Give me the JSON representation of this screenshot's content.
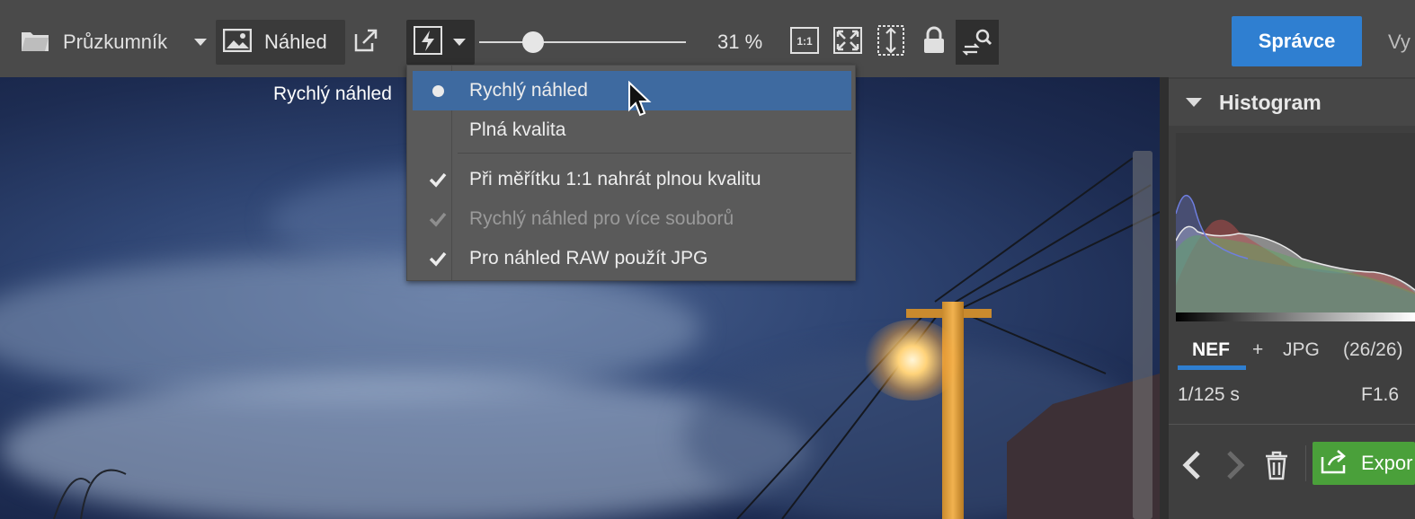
{
  "toolbar": {
    "explorer_label": "Průzkumník",
    "preview_label": "Náhled",
    "zoom_value": "31 %",
    "zoom_slider_fraction": 0.26,
    "one_to_one_label": "1:1",
    "manager_label": "Správce",
    "next_tab_label": "Vy"
  },
  "viewport": {
    "overlay_text": "Rychlý náhled"
  },
  "quality_menu": {
    "items": [
      {
        "label": "Rychlý náhled",
        "indicator": "dot",
        "active": true,
        "disabled": false
      },
      {
        "label": "Plná kvalita",
        "indicator": "none",
        "active": false,
        "disabled": false
      },
      {
        "label": "Při měřítku 1:1 nahrát plnou kvalitu",
        "indicator": "check",
        "active": false,
        "disabled": false
      },
      {
        "label": "Rychlý náhled pro více souborů",
        "indicator": "check",
        "active": false,
        "disabled": true
      },
      {
        "label": "Pro náhled RAW použít JPG",
        "indicator": "check",
        "active": false,
        "disabled": false
      }
    ]
  },
  "panel": {
    "histogram_title": "Histogram",
    "formats": {
      "primary": "NEF",
      "plus": "+",
      "secondary": "JPG",
      "count": "(26/26)"
    },
    "shutter": "1/125 s",
    "aperture": "F1.6",
    "export_label": "Expor"
  },
  "colors": {
    "accent_blue": "#2f7fd1",
    "menu_highlight": "#3e6aa0",
    "export_green": "#4aa03a"
  }
}
